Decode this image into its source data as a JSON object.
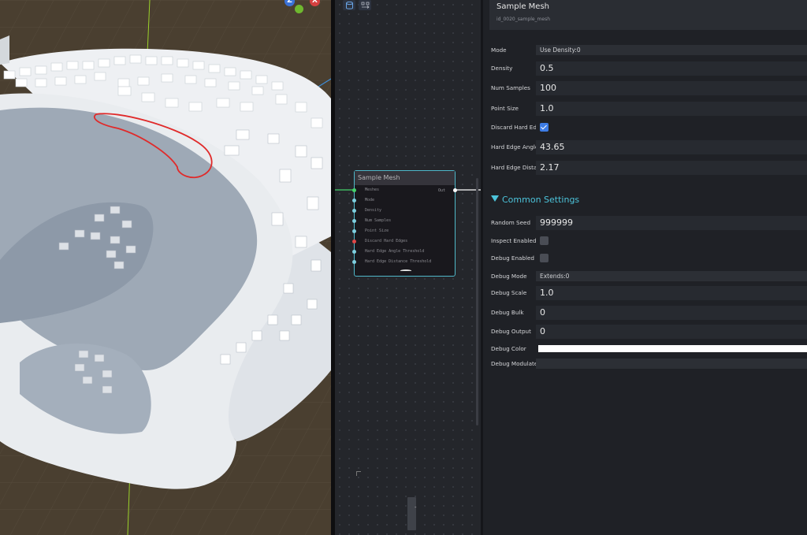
{
  "graph": {
    "toolbar": {
      "icons": [
        "database-icon",
        "graph-icon"
      ]
    },
    "node": {
      "title": "Sample Mesh",
      "output_label": "Out",
      "pins": [
        {
          "label": "Meshes",
          "color": "#45d16a"
        },
        {
          "label": "Mode",
          "color": "#7fd0e0"
        },
        {
          "label": "Density",
          "color": "#7fd0e0"
        },
        {
          "label": "Num Samples",
          "color": "#7fd0e0"
        },
        {
          "label": "Point Size",
          "color": "#7fd0e0"
        },
        {
          "label": "Discard Hard Edges",
          "color": "#e04848"
        },
        {
          "label": "Hard Edge Angle Threshold",
          "color": "#7fd0e0"
        },
        {
          "label": "Hard Edge Distance Threshold",
          "color": "#7fd0e0"
        }
      ]
    },
    "minimap": {
      "label": "-"
    }
  },
  "viewport": {
    "gizmo": {
      "z_label": "Z",
      "x_label": "X"
    },
    "colors": {
      "ground": "#4a3f30",
      "mesh": "#e9ecef",
      "annotation": "#e02a2a"
    }
  },
  "inspector": {
    "title": "Sample Mesh",
    "node_id": "id_0020_sample_mesh",
    "properties": {
      "mode": {
        "label": "Mode",
        "value": "Use Density:0"
      },
      "density": {
        "label": "Density",
        "value": "0.5"
      },
      "num_samples": {
        "label": "Num Samples",
        "value": "100"
      },
      "point_size": {
        "label": "Point Size",
        "value": "1.0"
      },
      "discard_hard_edges": {
        "label": "Discard Hard Edges",
        "checked": true
      },
      "hard_edge_angle": {
        "label": "Hard Edge Angle Threshold",
        "value": "43.65"
      },
      "hard_edge_distance": {
        "label": "Hard Edge Distance Threshold",
        "value": "2.17"
      }
    },
    "common_settings": {
      "header": "Common Settings",
      "random_seed": {
        "label": "Random Seed",
        "value": "999999"
      },
      "inspect_enabled": {
        "label": "Inspect Enabled",
        "checked": false
      },
      "debug_enabled": {
        "label": "Debug Enabled",
        "checked": false
      },
      "debug_mode": {
        "label": "Debug Mode",
        "value": "Extends:0"
      },
      "debug_scale": {
        "label": "Debug Scale",
        "value": "1.0"
      },
      "debug_bulk": {
        "label": "Debug Bulk",
        "value": "0"
      },
      "debug_output": {
        "label": "Debug Output",
        "value": "0"
      },
      "debug_color": {
        "label": "Debug Color",
        "value": "#ffffff"
      },
      "debug_modulate": {
        "label": "Debug Modulate",
        "value": ""
      }
    }
  }
}
